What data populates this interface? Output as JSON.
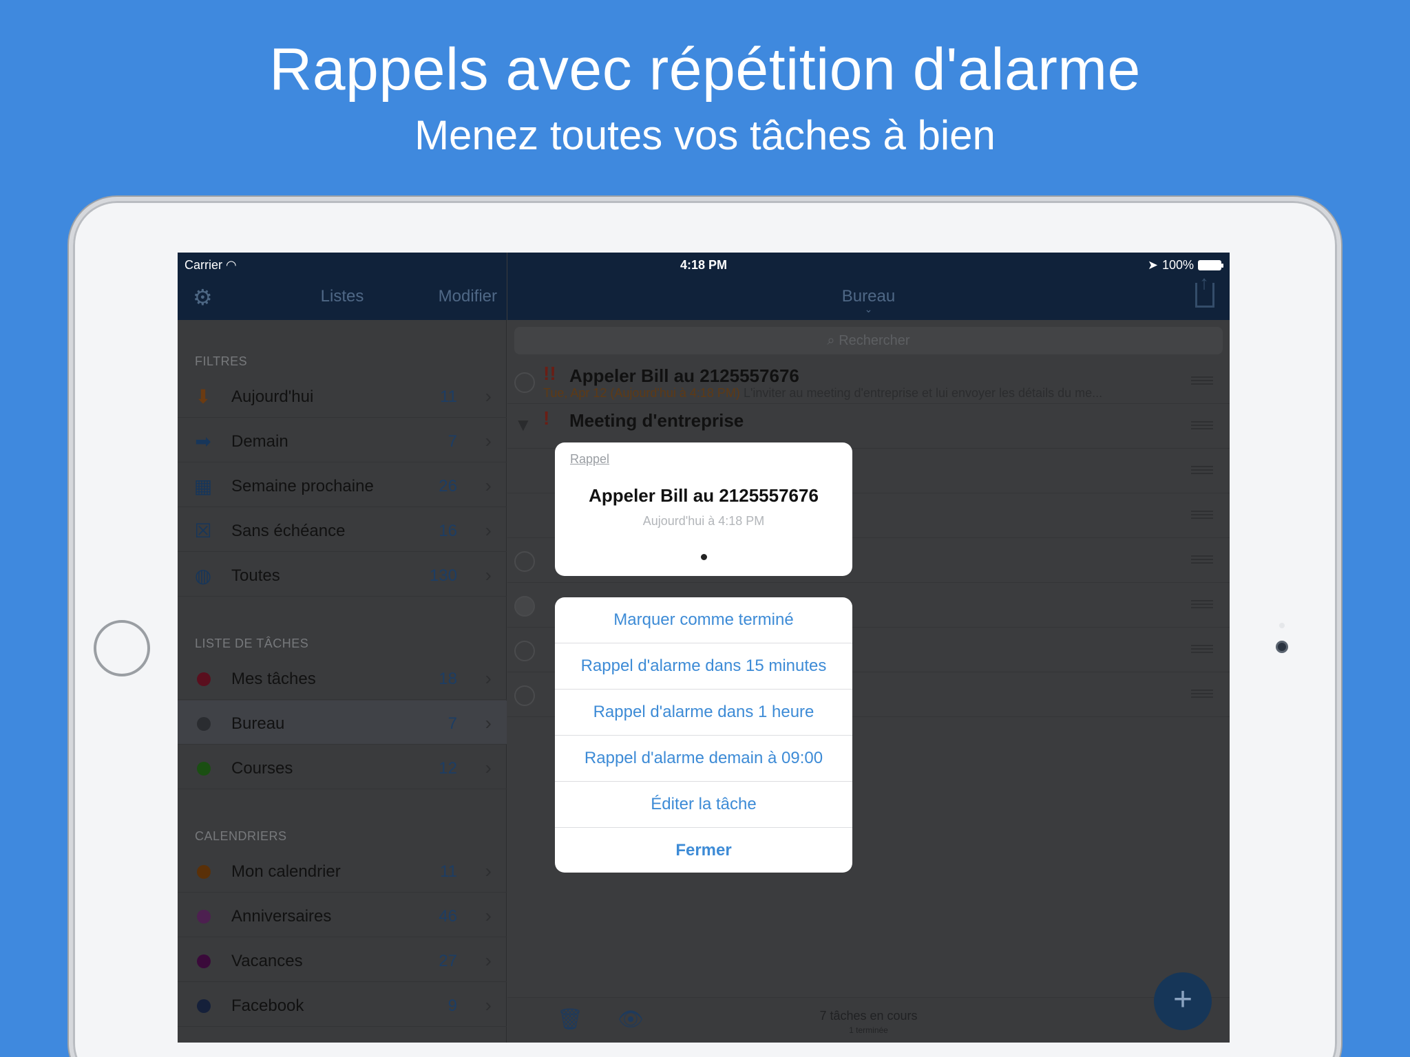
{
  "hero": {
    "title": "Rappels avec répétition d'alarme",
    "subtitle": "Menez toutes vos tâches à bien"
  },
  "statusbar": {
    "carrier": "Carrier",
    "time": "4:18 PM",
    "battery": "100%"
  },
  "sidebar": {
    "header": {
      "title": "Listes",
      "edit": "Modifier",
      "settings_icon": "gear-icon"
    },
    "sections": {
      "filters": "FILTRES",
      "task_lists": "LISTE DE TÂCHES",
      "calendars": "CALENDRIERS"
    },
    "filters": [
      {
        "label": "Aujourd'hui",
        "count": "11",
        "icon": "arrow-down-icon",
        "color": "#6b3b12"
      },
      {
        "label": "Demain",
        "count": "7",
        "icon": "arrow-right-icon",
        "color": "#17365a"
      },
      {
        "label": "Semaine prochaine",
        "count": "26",
        "icon": "grid-calendar-icon",
        "color": "#17365a"
      },
      {
        "label": "Sans échéance",
        "count": "16",
        "icon": "no-date-calendar-icon",
        "color": "#17365a"
      },
      {
        "label": "Toutes",
        "count": "130",
        "icon": "globe-icon",
        "color": "#17365a"
      }
    ],
    "task_lists": [
      {
        "label": "Mes tâches",
        "count": "18",
        "color": "#5a0f1e"
      },
      {
        "label": "Bureau",
        "count": "7",
        "color": "#2a2c30",
        "selected": true
      },
      {
        "label": "Courses",
        "count": "12",
        "color": "#1a4f12"
      }
    ],
    "calendars": [
      {
        "label": "Mon calendrier",
        "count": "11",
        "color": "#5a3008"
      },
      {
        "label": "Anniversaires",
        "count": "46",
        "color": "#4d2050"
      },
      {
        "label": "Vacances",
        "count": "27",
        "color": "#3a0a3a"
      },
      {
        "label": "Facebook",
        "count": "9",
        "color": "#15203a"
      }
    ]
  },
  "main": {
    "title": "Bureau",
    "search_placeholder": "Rechercher",
    "tasks": [
      {
        "priority": "!!",
        "name": "Appeler Bill au 2125557676",
        "due": "Tue, Apr 12 (Aujourd'hui à 4:18 PM)",
        "note": "L'inviter au meeting d'entreprise et lui envoyer les détails du me..."
      },
      {
        "priority": "!",
        "name": "Meeting d'entreprise"
      }
    ],
    "footer": {
      "count": "7 tâches en cours",
      "done": "1 terminée"
    }
  },
  "alert": {
    "kicker": "Rappel",
    "title": "Appeler Bill au 2125557676",
    "subtitle": "Aujourd'hui à 4:18 PM"
  },
  "actions": [
    "Marquer comme terminé",
    "Rappel d'alarme dans 15 minutes",
    "Rappel d'alarme dans 1 heure",
    "Rappel d'alarme demain à 09:00",
    "Éditer la tâche",
    "Fermer"
  ]
}
